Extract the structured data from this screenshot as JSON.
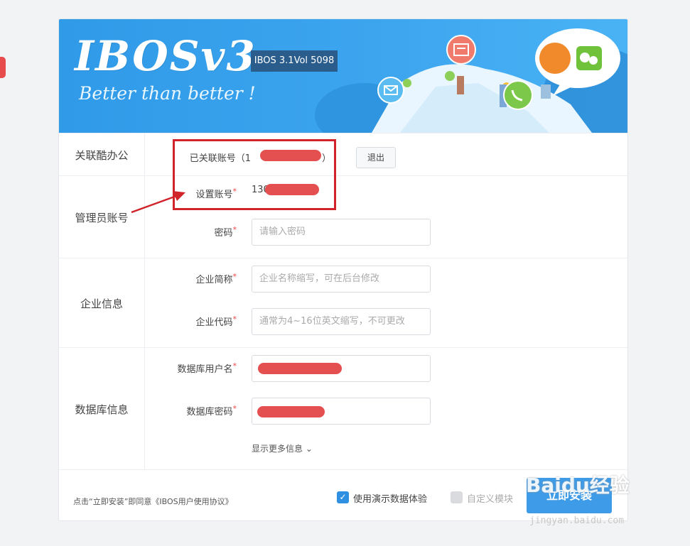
{
  "banner": {
    "logo": "IBOSv3",
    "tagline": "Better than better !",
    "version": "IBOS 3.1Vol 5098"
  },
  "sections": {
    "linked": {
      "label": "关联酷办公",
      "linked_account_label": "已关联账号（",
      "linked_account_value": "1",
      "linked_account_close": "）",
      "logout_label": "退出"
    },
    "admin": {
      "label": "管理员账号",
      "set_account_label": "设置账号",
      "set_account_value": "130",
      "password_label": "密码",
      "password_placeholder": "请输入密码"
    },
    "company": {
      "label": "企业信息",
      "short_name_label": "企业简称",
      "short_name_placeholder": "企业名称缩写，可在后台修改",
      "code_label": "企业代码",
      "code_placeholder": "通常为4~16位英文缩写，不可更改"
    },
    "database": {
      "label": "数据库信息",
      "user_label": "数据库用户名",
      "password_label": "数据库密码",
      "more_label": "显示更多信息"
    }
  },
  "required_mark": "*",
  "footer": {
    "agreement": "点击“立即安装”即同意《IBOS用户使用协议》",
    "demo_data_label": "使用演示数据体验",
    "demo_data_checked": true,
    "custom_module_label": "自定义模块",
    "custom_module_checked": false,
    "install_label": "立即安装"
  },
  "watermark": {
    "brand": "Baidu经验",
    "url": "jingyan.baidu.com"
  },
  "colors": {
    "brand_blue": "#3e9be8",
    "highlight_red": "#d0232a",
    "redaction": "#e45050"
  }
}
